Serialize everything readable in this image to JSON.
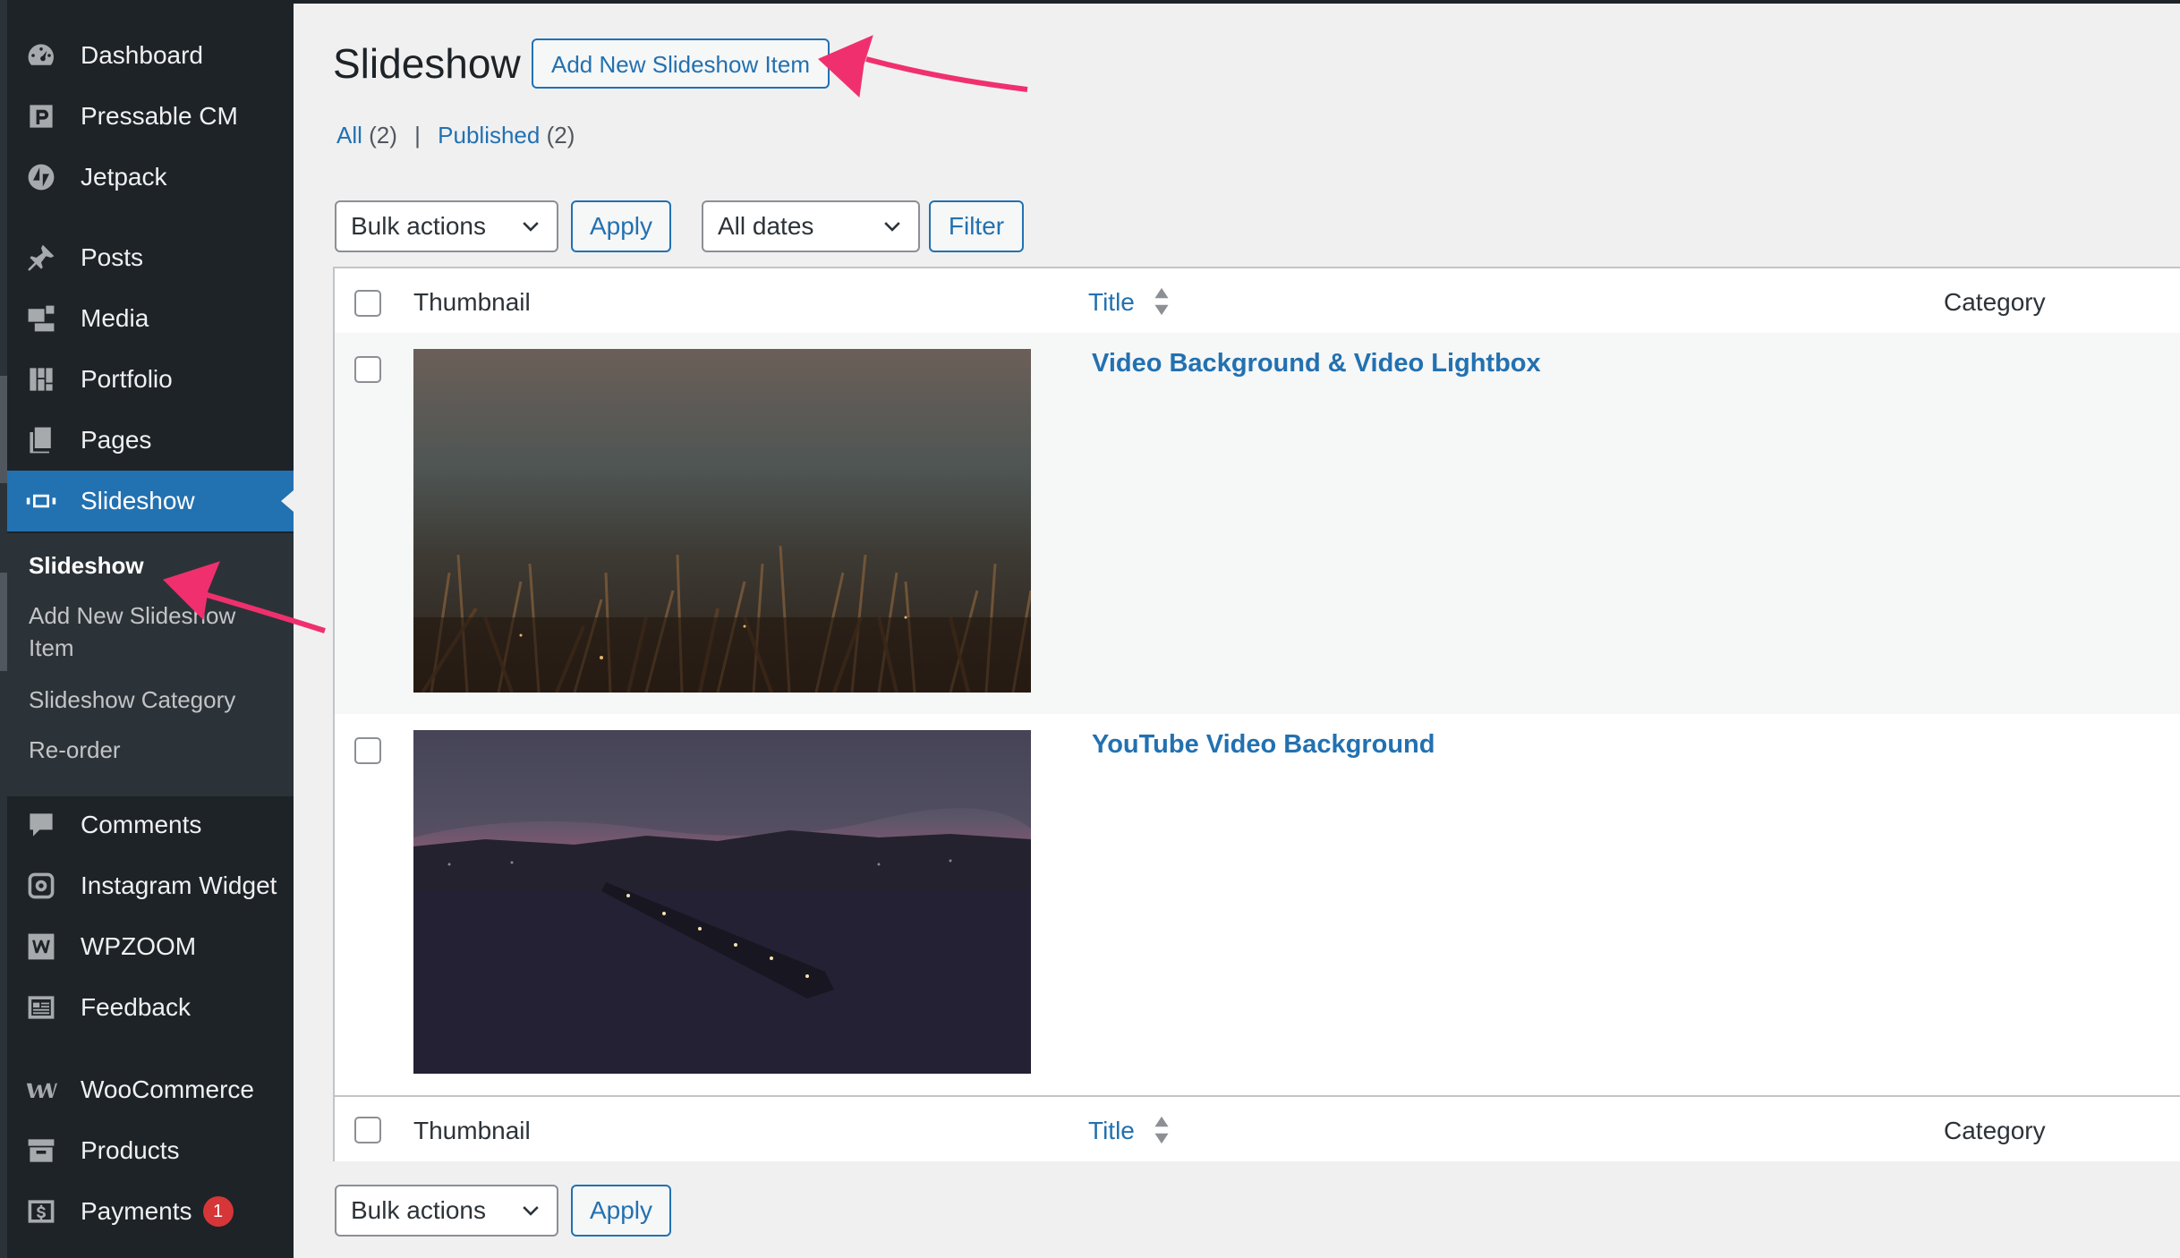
{
  "sidebar": {
    "items": [
      {
        "label": "Dashboard",
        "icon": "dashboard-icon"
      },
      {
        "label": "Pressable CM",
        "icon": "pressable-icon"
      },
      {
        "label": "Jetpack",
        "icon": "jetpack-icon"
      },
      {
        "label": "Posts",
        "icon": "pin-icon"
      },
      {
        "label": "Media",
        "icon": "media-icon"
      },
      {
        "label": "Portfolio",
        "icon": "portfolio-icon"
      },
      {
        "label": "Pages",
        "icon": "pages-icon"
      },
      {
        "label": "Slideshow",
        "icon": "slideshow-icon",
        "active": true
      },
      {
        "label": "Comments",
        "icon": "comment-icon"
      },
      {
        "label": "Instagram Widget",
        "icon": "instagram-icon"
      },
      {
        "label": "WPZOOM",
        "icon": "wpzoom-icon"
      },
      {
        "label": "Feedback",
        "icon": "feedback-icon"
      },
      {
        "label": "WooCommerce",
        "icon": "woocommerce-icon"
      },
      {
        "label": "Products",
        "icon": "archive-icon"
      },
      {
        "label": "Payments",
        "icon": "payments-icon",
        "badge": "1"
      }
    ],
    "submenu": [
      {
        "label": "Slideshow",
        "current": true
      },
      {
        "label": "Add New Slideshow Item"
      },
      {
        "label": "Slideshow Category"
      },
      {
        "label": "Re-order"
      }
    ]
  },
  "page": {
    "title": "Slideshow",
    "add_new_label": "Add New Slideshow Item"
  },
  "filters": {
    "all_label": "All",
    "all_count": "(2)",
    "separator": "|",
    "published_label": "Published",
    "published_count": "(2)"
  },
  "tablenav": {
    "bulk_actions": "Bulk actions",
    "apply": "Apply",
    "all_dates": "All dates",
    "filter": "Filter"
  },
  "table": {
    "columns": {
      "thumbnail": "Thumbnail",
      "title": "Title",
      "category": "Category"
    },
    "rows": [
      {
        "title": "Video Background & Video Lightbox",
        "thumb": "grass-at-dusk"
      },
      {
        "title": "YouTube Video Background",
        "thumb": "pier-at-sunset"
      }
    ]
  },
  "colors": {
    "accent": "#2271b1",
    "sidebar_bg": "#1d2327",
    "submenu_bg": "#2c3338",
    "annotation_arrow": "#f0306e"
  }
}
